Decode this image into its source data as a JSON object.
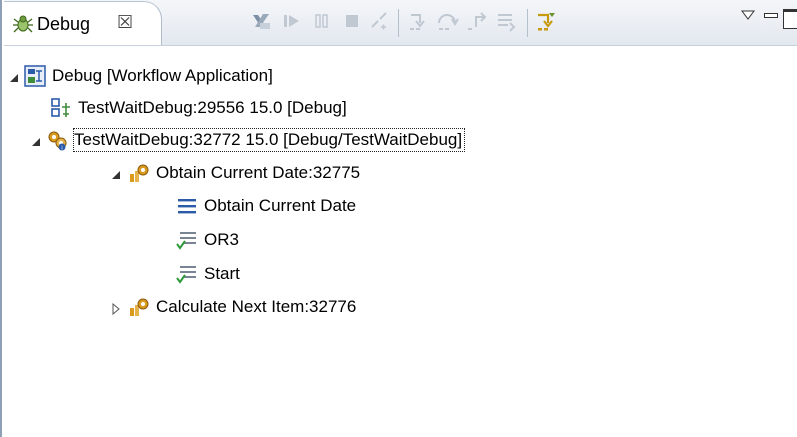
{
  "view": {
    "tab_title": "Debug",
    "tab_close_glyph": "☒",
    "icon": "debug-bug-icon"
  },
  "toolbar": {
    "buttons": [
      {
        "name": "remove-all-terminated",
        "icon": "remove-terminated-icon",
        "enabled": true
      },
      {
        "name": "resume",
        "icon": "resume-icon",
        "enabled": false
      },
      {
        "name": "suspend",
        "icon": "suspend-icon",
        "enabled": false
      },
      {
        "name": "terminate",
        "icon": "terminate-icon",
        "enabled": false
      },
      {
        "name": "disconnect",
        "icon": "disconnect-icon",
        "enabled": false
      },
      {
        "name": "step-into",
        "icon": "step-into-icon",
        "enabled": false
      },
      {
        "name": "step-over",
        "icon": "step-over-icon",
        "enabled": false
      },
      {
        "name": "step-return",
        "icon": "step-return-icon",
        "enabled": false
      },
      {
        "name": "drop-to-frame",
        "icon": "drop-to-frame-icon",
        "enabled": false
      },
      {
        "name": "use-step-filters",
        "icon": "step-filters-icon",
        "enabled": true
      }
    ],
    "view_menu_icon": "chevron-down-icon",
    "minimize_icon": "minimize-icon",
    "maximize_icon": "maximize-icon"
  },
  "tree": {
    "launch": {
      "label": "Debug [Workflow Application]",
      "expanded": true,
      "icon": "launch-config-icon"
    },
    "targets": [
      {
        "label": "TestWaitDebug:29556 15.0 [Debug]",
        "icon": "debug-target-terminated-icon"
      },
      {
        "label": "TestWaitDebug:32772 15.0 [Debug/TestWaitDebug]",
        "icon": "debug-target-running-icon",
        "expanded": true,
        "selected": true,
        "threads": [
          {
            "label": "Obtain Current Date:32775",
            "icon": "workflow-thread-icon",
            "expanded": true,
            "frames": [
              {
                "label": "Obtain Current Date",
                "icon": "stack-frame-current-icon"
              },
              {
                "label": "OR3",
                "icon": "stack-frame-done-icon"
              },
              {
                "label": "Start",
                "icon": "stack-frame-done-icon"
              }
            ]
          },
          {
            "label": "Calculate Next Item:32776",
            "icon": "workflow-thread-icon",
            "expanded": false
          }
        ]
      }
    ]
  },
  "colors": {
    "frame_border": "#8da0b6",
    "header_bg": "#e3e8ef",
    "frame_blue": "#2a5aa8",
    "check_green": "#2e9a3a",
    "gear_orange": "#d99a1e"
  }
}
